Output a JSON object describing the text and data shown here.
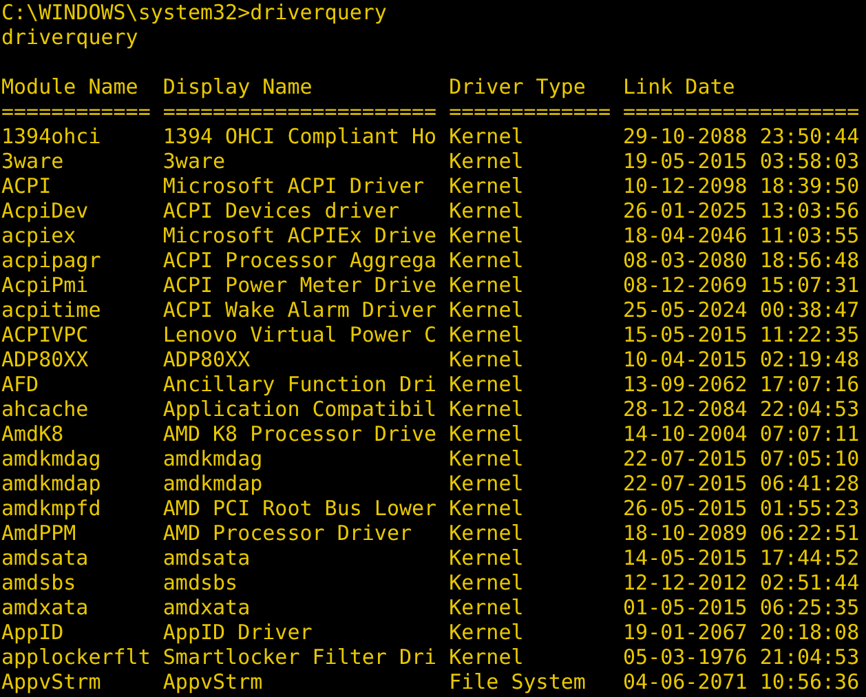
{
  "console": {
    "lines": [
      {
        "text": "C:\\WINDOWS\\system32>driverquery"
      },
      {
        "text": "driverquery"
      }
    ]
  },
  "table": {
    "columns": [
      {
        "label": "Module Name",
        "separator": "============"
      },
      {
        "label": "Display Name",
        "separator": "======================"
      },
      {
        "label": "Driver Type",
        "separator": "============="
      },
      {
        "label": "Link Date",
        "separator": "==================="
      }
    ],
    "rows": [
      [
        "1394ohci",
        "1394 OHCI Compliant Ho",
        "Kernel",
        "29-10-2088 23:50:44"
      ],
      [
        "3ware",
        "3ware",
        "Kernel",
        "19-05-2015 03:58:03"
      ],
      [
        "ACPI",
        "Microsoft ACPI Driver",
        "Kernel",
        "10-12-2098 18:39:50"
      ],
      [
        "AcpiDev",
        "ACPI Devices driver",
        "Kernel",
        "26-01-2025 13:03:56"
      ],
      [
        "acpiex",
        "Microsoft ACPIEx Drive",
        "Kernel",
        "18-04-2046 11:03:55"
      ],
      [
        "acpipagr",
        "ACPI Processor Aggrega",
        "Kernel",
        "08-03-2080 18:56:48"
      ],
      [
        "AcpiPmi",
        "ACPI Power Meter Drive",
        "Kernel",
        "08-12-2069 15:07:31"
      ],
      [
        "acpitime",
        "ACPI Wake Alarm Driver",
        "Kernel",
        "25-05-2024 00:38:47"
      ],
      [
        "ACPIVPC",
        "Lenovo Virtual Power C",
        "Kernel",
        "15-05-2015 11:22:35"
      ],
      [
        "ADP80XX",
        "ADP80XX",
        "Kernel",
        "10-04-2015 02:19:48"
      ],
      [
        "AFD",
        "Ancillary Function Dri",
        "Kernel",
        "13-09-2062 17:07:16"
      ],
      [
        "ahcache",
        "Application Compatibil",
        "Kernel",
        "28-12-2084 22:04:53"
      ],
      [
        "AmdK8",
        "AMD K8 Processor Drive",
        "Kernel",
        "14-10-2004 07:07:11"
      ],
      [
        "amdkmdag",
        "amdkmdag",
        "Kernel",
        "22-07-2015 07:05:10"
      ],
      [
        "amdkmdap",
        "amdkmdap",
        "Kernel",
        "22-07-2015 06:41:28"
      ],
      [
        "amdkmpfd",
        "AMD PCI Root Bus Lower",
        "Kernel",
        "26-05-2015 01:55:23"
      ],
      [
        "AmdPPM",
        "AMD Processor Driver",
        "Kernel",
        "18-10-2089 06:22:51"
      ],
      [
        "amdsata",
        "amdsata",
        "Kernel",
        "14-05-2015 17:44:52"
      ],
      [
        "amdsbs",
        "amdsbs",
        "Kernel",
        "12-12-2012 02:51:44"
      ],
      [
        "amdxata",
        "amdxata",
        "Kernel",
        "01-05-2015 06:25:35"
      ],
      [
        "AppID",
        "AppID Driver",
        "Kernel",
        "19-01-2067 20:18:08"
      ],
      [
        "applockerflt",
        "Smartlocker Filter Dri",
        "Kernel",
        "05-03-1976 21:04:53"
      ],
      [
        "AppvStrm",
        "AppvStrm",
        "File System",
        "04-06-2071 10:56:36"
      ]
    ]
  }
}
